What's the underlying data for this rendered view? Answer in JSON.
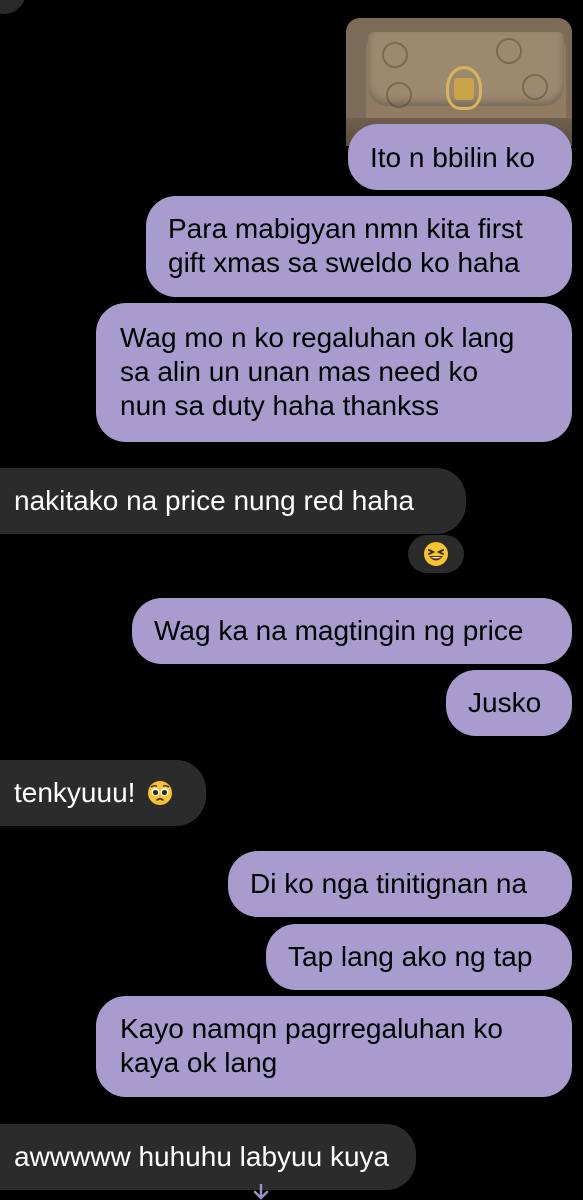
{
  "messages": [
    {
      "id": 1,
      "side": "sent",
      "type": "image",
      "description": "bag-photo"
    },
    {
      "id": 2,
      "side": "sent",
      "text": "Ito n bbilin ko"
    },
    {
      "id": 3,
      "side": "sent",
      "lines": [
        "Para mabigyan nmn kita first",
        "gift xmas sa sweldo ko haha"
      ]
    },
    {
      "id": 4,
      "side": "sent",
      "lines": [
        "Wag mo n ko regaluhan ok lang",
        "sa alin un unan mas need ko",
        "nun sa duty haha thankss"
      ]
    },
    {
      "id": 5,
      "side": "received",
      "text": "nakitako na price nung red haha",
      "reaction": "grinning-squinting-face-emoji"
    },
    {
      "id": 6,
      "side": "sent",
      "text": "Wag ka na magtingin ng price"
    },
    {
      "id": 7,
      "side": "sent",
      "text": "Jusko"
    },
    {
      "id": 8,
      "side": "received",
      "text": "tenkyuuu!",
      "emoji": "pleading-face-emoji"
    },
    {
      "id": 9,
      "side": "sent",
      "text": "Di ko nga tinitignan na"
    },
    {
      "id": 10,
      "side": "sent",
      "text": "Tap lang ako ng tap"
    },
    {
      "id": 11,
      "side": "sent",
      "lines": [
        "Kayo namqn pagrregaluhan ko",
        "kaya ok lang"
      ]
    },
    {
      "id": 12,
      "side": "received",
      "text": "awwwww huhuhu labyuu kuya"
    }
  ],
  "colors": {
    "background": "#000000",
    "sent_bubble": "#a89ccf",
    "received_bubble": "#2b2b2b",
    "sent_text": "#000000",
    "received_text": "#ffffff"
  },
  "icons": {
    "reaction": "grinning-squinting-face-emoji",
    "inline_emoji": "pleading-face-emoji",
    "scroll": "scroll-down-arrow-icon"
  }
}
